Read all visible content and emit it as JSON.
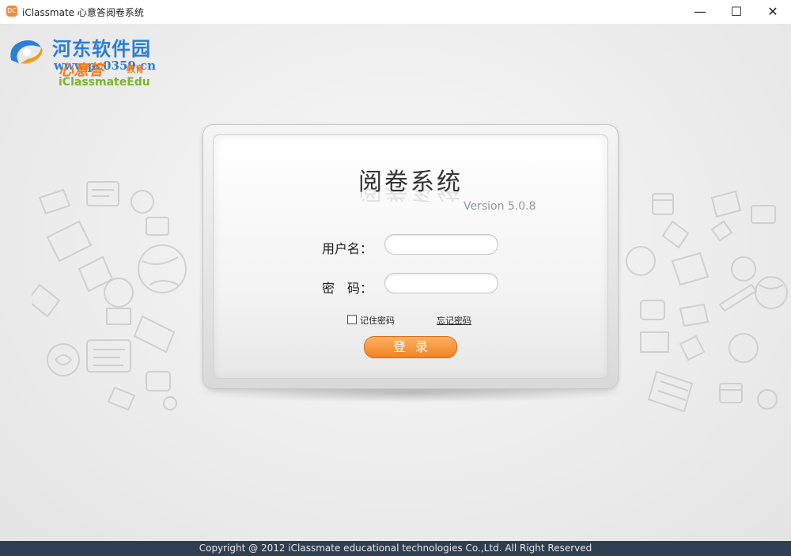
{
  "window": {
    "app_icon_text": "DC",
    "title": "iClassmate 心意答阅卷系统",
    "min_glyph": "—",
    "max_glyph": "☐",
    "close_glyph": "✕"
  },
  "watermark": {
    "site_name": "河东软件园",
    "url": "www.pc0359.cn"
  },
  "brand": {
    "name_cn": "心意答",
    "sub_cn": "教育",
    "name_en": "iClassmateEdu",
    "color_orange": "#ef7d22",
    "color_green": "#7cb431"
  },
  "login": {
    "title": "阅卷系统",
    "version": "Version 5.0.8",
    "username_label": "用户名：",
    "username_value": "",
    "password_label": "密　码：",
    "password_value": "",
    "remember_label": "记住密码",
    "forgot_label": "忘记密码",
    "login_button": "登录",
    "button_color": "#f08324"
  },
  "footer": {
    "copyright": "Copyright @ 2012 iClassmate educational technologies Co.,Ltd. All Right Reserved"
  }
}
